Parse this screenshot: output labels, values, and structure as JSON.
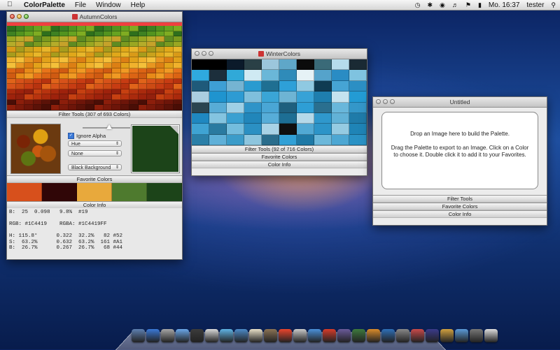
{
  "menubar": {
    "app_name": "ColorPalette",
    "menus": [
      "File",
      "Window",
      "Help"
    ],
    "clock": "Mo. 16:37",
    "user": "tester"
  },
  "autumn_window": {
    "title": "AutumnColors",
    "palette_bands": [
      [
        "#2e6f1c",
        "#3e8122",
        "#52931f",
        "#67a321",
        "#7fac22"
      ],
      [
        "#5e8b22",
        "#7b9a1f",
        "#9aa722",
        "#b5ac2a",
        "#c6a22a"
      ],
      [
        "#a79c1d",
        "#c9a21c",
        "#e0a81a",
        "#e8b62a",
        "#d99a18"
      ],
      [
        "#e2a21a",
        "#f1b22d",
        "#f4c03a",
        "#e89620",
        "#dc7f14"
      ],
      [
        "#e88a18",
        "#f09a24",
        "#e8741a",
        "#dc6414",
        "#cf5a12"
      ],
      [
        "#e0641a",
        "#d7521a",
        "#cc4a14",
        "#c73c13",
        "#b7330f"
      ],
      [
        "#c64011",
        "#b8330f",
        "#aa2a0d",
        "#9e220c",
        "#93200d"
      ],
      [
        "#8c1e0b",
        "#7b190a",
        "#6d1509",
        "#5b1208",
        "#4a0e06"
      ]
    ],
    "filter_bar": "Filter Tools (307 of 693 Colors)",
    "ignore_alpha_label": "Ignore Alpha",
    "sort_popup": "Hue",
    "filter_popup": "None",
    "background_popup": "Black Background",
    "selected_color": "#1C4419",
    "favorites_bar": "Favorite Colors",
    "favorites": [
      "#d7501c",
      "#300607",
      "#e8a93c",
      "#4e7a2e",
      "#1c4419"
    ],
    "color_info_bar": "Color Info",
    "info_lines": [
      "B:  25  0.098   9.8%  #19",
      "",
      "RGB: #1C4419    RGBA: #1C4419FF",
      "",
      "H: 115.8°      0.322  32.2%   82 #52",
      "S:  63.2%      0.632  63.2%  161 #A1",
      "B:  26.7%      0.267  26.7%   68 #44"
    ]
  },
  "winter_window": {
    "title": "WinterColors",
    "colors": [
      "#000000",
      "#000000",
      "#0b1a2a",
      "#2a4046",
      "#9cc6dc",
      "#5fa7c8",
      "#0b0b0b",
      "#3a6a78",
      "#b6dcec",
      "#1a2a34",
      "#2fa9df",
      "#1c2f3c",
      "#30a9d8",
      "#cfeaf3",
      "#6ab7d8",
      "#2f8bb9",
      "#e6f2f6",
      "#55a3cb",
      "#2a8cc4",
      "#7fc3e0",
      "#1f5a7a",
      "#3e9fd4",
      "#75b4d2",
      "#2a9bd0",
      "#1f6f92",
      "#2ea0d8",
      "#8fc9e2",
      "#0f3b52",
      "#46a4d4",
      "#2b8fc4",
      "#aacde0",
      "#1f94cf",
      "#2d9bd3",
      "#7fbfdc",
      "#3aa5d6",
      "#6eb4d4",
      "#37a2d6",
      "#1e7eae",
      "#c5e3ef",
      "#239bd4",
      "#2a4450",
      "#58acd6",
      "#9fd0e6",
      "#2f94c8",
      "#4aa6d5",
      "#1e5f7e",
      "#2e9ed5",
      "#2a6f8f",
      "#69b7db",
      "#3497c9",
      "#1f88c0",
      "#84c4e0",
      "#39a0d1",
      "#2186ba",
      "#57add8",
      "#1d6e94",
      "#b5d9e9",
      "#2f98cc",
      "#62b2d7",
      "#1f7ba9",
      "#3fa3d3",
      "#2a7aa0",
      "#74bddd",
      "#2b90c3",
      "#a9d3e6",
      "#0f0f0f",
      "#51a9d4",
      "#2c94c8",
      "#96cbe2",
      "#1f84b6",
      "#2b7fa8",
      "#5fb0d8",
      "#3b9cc9",
      "#8dc5de",
      "#2a6d8c",
      "#31a0d6",
      "#1e79a6",
      "#6cb8da",
      "#4da7d3",
      "#2a92c5"
    ],
    "filter_bar": "Filter Tools (92 of 716 Colors)",
    "favorites_bar": "Favorite Colors",
    "color_info_bar": "Color Info"
  },
  "untitled_window": {
    "title": "Untitled",
    "drop_text_1": "Drop an Image here to build the Palette.",
    "drop_text_2": "Drag the Palette to export to an Image. Click on a Color to choose it. Double click it to add it to your Favorites.",
    "filter_bar": "Filter Tools",
    "favorites_bar": "Favorite Colors",
    "color_info_bar": "Color Info"
  },
  "dock": {
    "icons": [
      "#5d7fb0",
      "#3a78d6",
      "#a5a5a5",
      "#6aa6e8",
      "#3c3c3c",
      "#d9d9d9",
      "#5fb3e3",
      "#4c8ac8",
      "#e8e0c8",
      "#8b7355",
      "#e8452d",
      "#c9c9c9",
      "#4a90d9",
      "#d63c2a",
      "#6a5a9a",
      "#3e7a3e",
      "#d98b2b",
      "#2e6fb7",
      "#888888",
      "#c84a4a",
      "#3a3a8a",
      "#d0a040",
      "#5a9ad8",
      "#777777",
      "#dddddd"
    ]
  }
}
